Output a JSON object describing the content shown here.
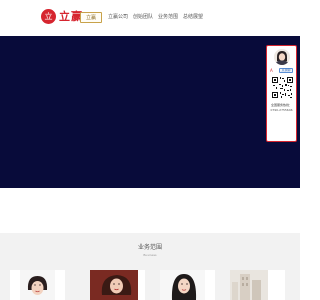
{
  "brand": {
    "logo_mark": "立",
    "name": "立赢"
  },
  "nav": {
    "items": [
      {
        "label": "立赢",
        "active": true
      },
      {
        "label": "立赢公司",
        "active": false
      },
      {
        "label": "创始团队",
        "active": false
      },
      {
        "label": "业务范围",
        "active": false
      },
      {
        "label": "总结展望",
        "active": false
      }
    ]
  },
  "floating_contact": {
    "chat_button": "点我聊",
    "tel_label": "全国服务热线：",
    "tel_number": "0790-2755646",
    "stamp": "A"
  },
  "business_section": {
    "title": "业务范围",
    "subtitle": "Business"
  },
  "colors": {
    "brand_red": "#d6252f",
    "hero_navy": "#080b3a",
    "nav_active_gold": "#c8a24a",
    "section_bg": "#f2f2f2"
  }
}
